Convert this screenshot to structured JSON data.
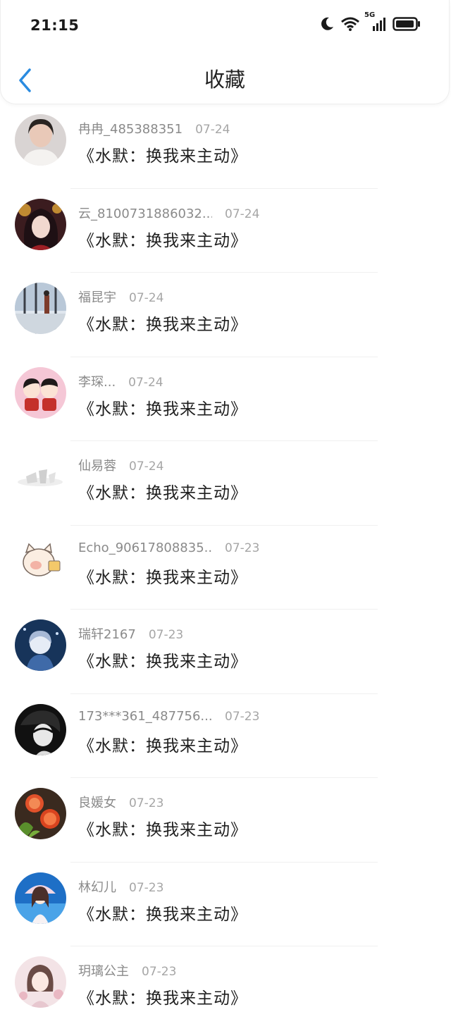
{
  "status_bar": {
    "time": "21:15",
    "network_label": "5G"
  },
  "header": {
    "title": "收藏"
  },
  "favorites": [
    {
      "user": "冉冉_485388351",
      "date": "07-24",
      "text": "《水默：换我来主动》"
    },
    {
      "user": "云_8100731886032...",
      "date": "07-24",
      "text": "《水默：换我来主动》"
    },
    {
      "user": "福昆宇",
      "date": "07-24",
      "text": "《水默：换我来主动》"
    },
    {
      "user": "李琛...",
      "date": "07-24",
      "text": "《水默：换我来主动》"
    },
    {
      "user": "仙易蓉",
      "date": "07-24",
      "text": "《水默：换我来主动》"
    },
    {
      "user": "Echo_90617808835...",
      "date": "07-23",
      "text": "《水默：换我来主动》"
    },
    {
      "user": "瑞轩2167",
      "date": "07-23",
      "text": "《水默：换我来主动》"
    },
    {
      "user": "173***361_487756...",
      "date": "07-23",
      "text": "《水默：换我来主动》"
    },
    {
      "user": "良媛女",
      "date": "07-23",
      "text": "《水默：换我来主动》"
    },
    {
      "user": "林幻儿",
      "date": "07-23",
      "text": "《水默：换我来主动》"
    },
    {
      "user": "玥璃公主",
      "date": "07-23",
      "text": "《水默：换我来主动》"
    }
  ]
}
